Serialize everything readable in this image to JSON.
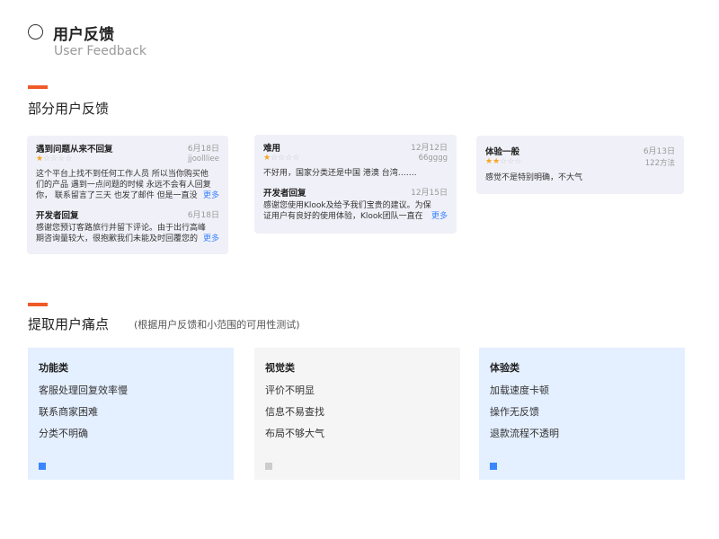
{
  "header": {
    "title": "用户反馈",
    "subtitle": "User Feedback"
  },
  "colors": {
    "accent": "#f05a28",
    "link": "#3a86ff",
    "star": "#f5a623",
    "pain_blue": "#e4efff",
    "pain_gray": "#f5f5f5",
    "square_blue": "#3a86ff",
    "square_gray": "#cccccc"
  },
  "section1": {
    "title": "部分用户反馈"
  },
  "reviews": [
    {
      "headline": "遇到问题从来不回复",
      "date": "6月18日",
      "stars": 1,
      "user": "jjoollliee",
      "body": [
        "这个平台上找不到任何工作人员 所以当你购买他",
        "们的产品 遇到一点问题的时候 永远不会有人回复",
        "你， 联系留言了三天 也发了邮件 但是一直没"
      ],
      "more": "更多",
      "reply": {
        "label": "开发者回复",
        "date": "6月18日",
        "body": [
          "感谢您预订客路旅行并留下评论。由于出行高峰",
          "期咨询量较大，很抱歉我们未能及时回覆您的"
        ],
        "more": "更多"
      }
    },
    {
      "headline": "难用",
      "date": "12月12日",
      "stars": 1,
      "user": "66gggg",
      "body": [
        "不好用，国家分类还是中国 港澳 台湾……."
      ],
      "reply": {
        "label": "开发者回复",
        "date": "12月15日",
        "body": [
          "感谢您使用Klook及给予我们宝贵的建议。为保",
          "证用户有良好的使用体验，Klook团队一直在"
        ],
        "more": "更多"
      }
    },
    {
      "headline": "体验一般",
      "date": "6月13日",
      "stars": 2,
      "user": "122方法",
      "body": [
        "感觉不是特别明确，不大气"
      ]
    }
  ],
  "section2": {
    "title": "提取用户痛点",
    "note": "(根据用户反馈和小范围的可用性测试)"
  },
  "pain_points": [
    {
      "title": "功能类",
      "items": [
        "客服处理回复效率慢",
        "联系商家困难",
        "分类不明确"
      ],
      "square": "blue"
    },
    {
      "title": "视觉类",
      "items": [
        "评价不明显",
        "信息不易查找",
        "布局不够大气"
      ],
      "square": "gray"
    },
    {
      "title": "体验类",
      "items": [
        "加载速度卡顿",
        "操作无反馈",
        "退款流程不透明"
      ],
      "square": "blue"
    }
  ]
}
